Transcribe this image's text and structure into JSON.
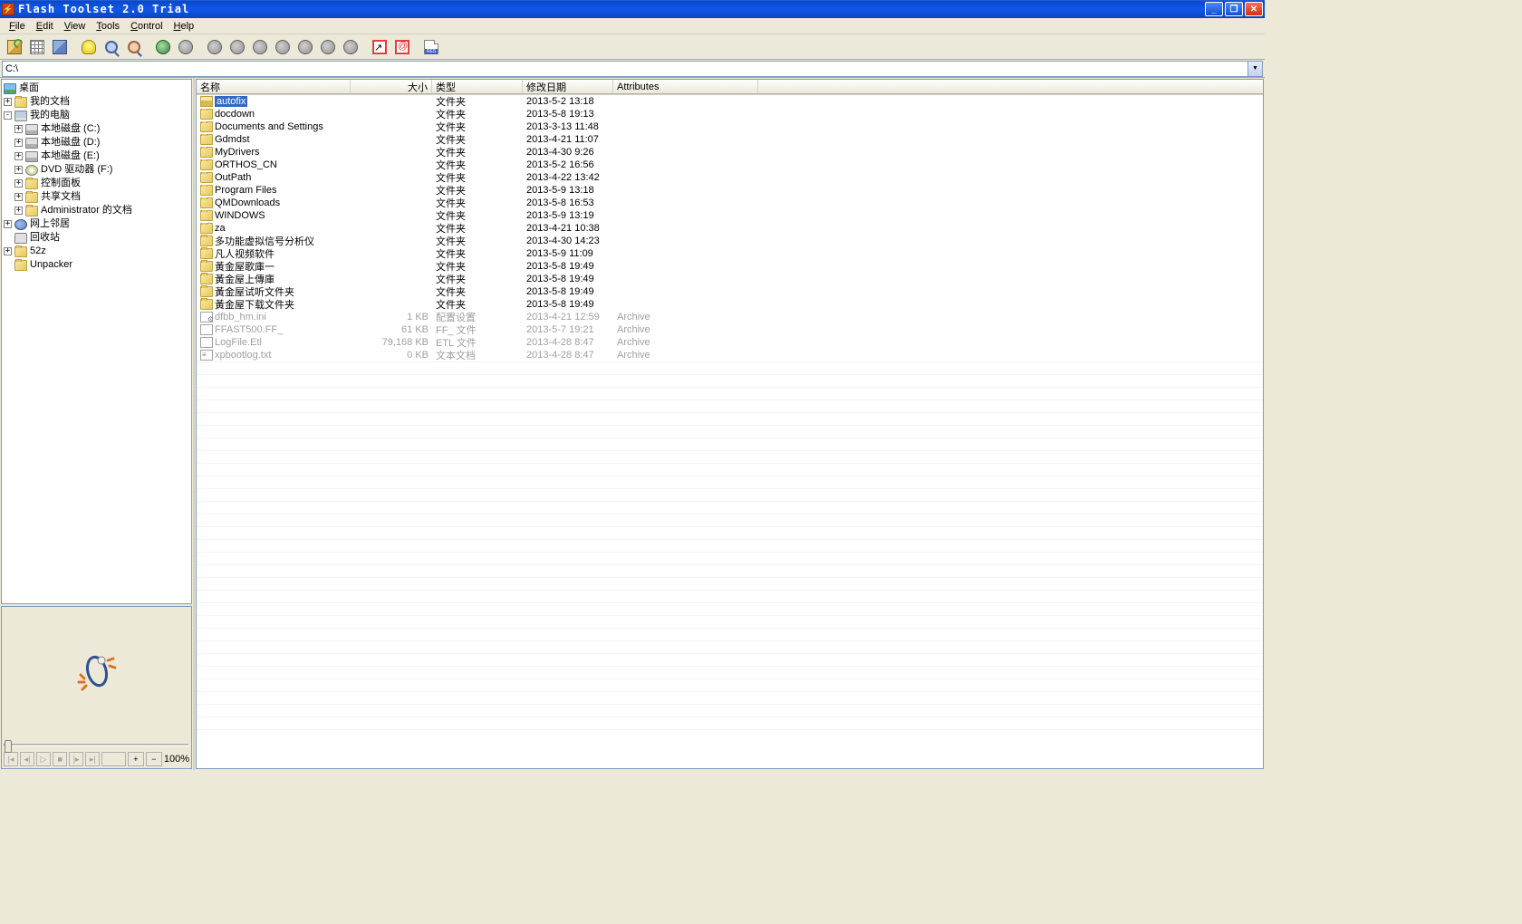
{
  "title": "Flash Toolset 2.0 Trial",
  "menu": {
    "file": "File",
    "file_u": "F",
    "edit": "Edit",
    "edit_u": "E",
    "view": "View",
    "view_u": "V",
    "tools": "Tools",
    "tools_u": "T",
    "control": "Control",
    "control_u": "C",
    "help": "Help",
    "help_u": "H"
  },
  "path": "C:\\",
  "tree": {
    "root": "桌面",
    "mydocs": "我的文档",
    "mycomputer": "我的电脑",
    "drive_c": "本地磁盘 (C:)",
    "drive_d": "本地磁盘 (D:)",
    "drive_e": "本地磁盘 (E:)",
    "drive_f": "DVD 驱动器 (F:)",
    "control_panel": "控制面板",
    "shared_docs": "共享文档",
    "admin_docs": "Administrator 的文档",
    "network": "网上邻居",
    "recycle": "回收站",
    "n52z": "52z",
    "unpacker": "Unpacker"
  },
  "columns": {
    "name": "名称",
    "size": "大小",
    "type": "类型",
    "date": "修改日期",
    "attr": "Attributes"
  },
  "files": [
    {
      "name": "autofix",
      "size": "",
      "type": "文件夹",
      "date": "2013-5-2 13:18",
      "attr": "",
      "icon": "folder-open",
      "selected": true
    },
    {
      "name": "docdown",
      "size": "",
      "type": "文件夹",
      "date": "2013-5-8 19:13",
      "attr": "",
      "icon": "folder"
    },
    {
      "name": "Documents and Settings",
      "size": "",
      "type": "文件夹",
      "date": "2013-3-13 11:48",
      "attr": "",
      "icon": "folder"
    },
    {
      "name": "Gdmdst",
      "size": "",
      "type": "文件夹",
      "date": "2013-4-21 11:07",
      "attr": "",
      "icon": "folder"
    },
    {
      "name": "MyDrivers",
      "size": "",
      "type": "文件夹",
      "date": "2013-4-30 9:26",
      "attr": "",
      "icon": "folder"
    },
    {
      "name": "ORTHOS_CN",
      "size": "",
      "type": "文件夹",
      "date": "2013-5-2 16:56",
      "attr": "",
      "icon": "folder"
    },
    {
      "name": "OutPath",
      "size": "",
      "type": "文件夹",
      "date": "2013-4-22 13:42",
      "attr": "",
      "icon": "folder"
    },
    {
      "name": "Program Files",
      "size": "",
      "type": "文件夹",
      "date": "2013-5-9 13:18",
      "attr": "",
      "icon": "folder"
    },
    {
      "name": "QMDownloads",
      "size": "",
      "type": "文件夹",
      "date": "2013-5-8 16:53",
      "attr": "",
      "icon": "folder"
    },
    {
      "name": "WINDOWS",
      "size": "",
      "type": "文件夹",
      "date": "2013-5-9 13:19",
      "attr": "",
      "icon": "folder"
    },
    {
      "name": "za",
      "size": "",
      "type": "文件夹",
      "date": "2013-4-21 10:38",
      "attr": "",
      "icon": "folder"
    },
    {
      "name": "多功能虚拟信号分析仪",
      "size": "",
      "type": "文件夹",
      "date": "2013-4-30 14:23",
      "attr": "",
      "icon": "folder"
    },
    {
      "name": "凡人视频软件",
      "size": "",
      "type": "文件夹",
      "date": "2013-5-9 11:09",
      "attr": "",
      "icon": "folder"
    },
    {
      "name": "黃金屋歌庫一",
      "size": "",
      "type": "文件夹",
      "date": "2013-5-8 19:49",
      "attr": "",
      "icon": "folder"
    },
    {
      "name": "黃金屋上傳庫",
      "size": "",
      "type": "文件夹",
      "date": "2013-5-8 19:49",
      "attr": "",
      "icon": "folder"
    },
    {
      "name": "黃金屋试听文件夹",
      "size": "",
      "type": "文件夹",
      "date": "2013-5-8 19:49",
      "attr": "",
      "icon": "folder"
    },
    {
      "name": "黃金屋下载文件夹",
      "size": "",
      "type": "文件夹",
      "date": "2013-5-8 19:49",
      "attr": "",
      "icon": "folder"
    },
    {
      "name": "dfbb_hm.ini",
      "size": "1 KB",
      "type": "配置设置",
      "date": "2013-4-21 12:59",
      "attr": "Archive",
      "icon": "ini",
      "gray": true
    },
    {
      "name": "FFAST500.FF_",
      "size": "61 KB",
      "type": "FF_ 文件",
      "date": "2013-5-7 19:21",
      "attr": "Archive",
      "icon": "file",
      "gray": true
    },
    {
      "name": "LogFile.Etl",
      "size": "79,168 KB",
      "type": "ETL 文件",
      "date": "2013-4-28 8:47",
      "attr": "Archive",
      "icon": "file",
      "gray": true
    },
    {
      "name": "xpbootlog.txt",
      "size": "0 KB",
      "type": "文本文档",
      "date": "2013-4-28 8:47",
      "attr": "Archive",
      "icon": "txt",
      "gray": true
    }
  ],
  "preview": {
    "zoom": "100%",
    "plus": "+",
    "minus": "−"
  }
}
